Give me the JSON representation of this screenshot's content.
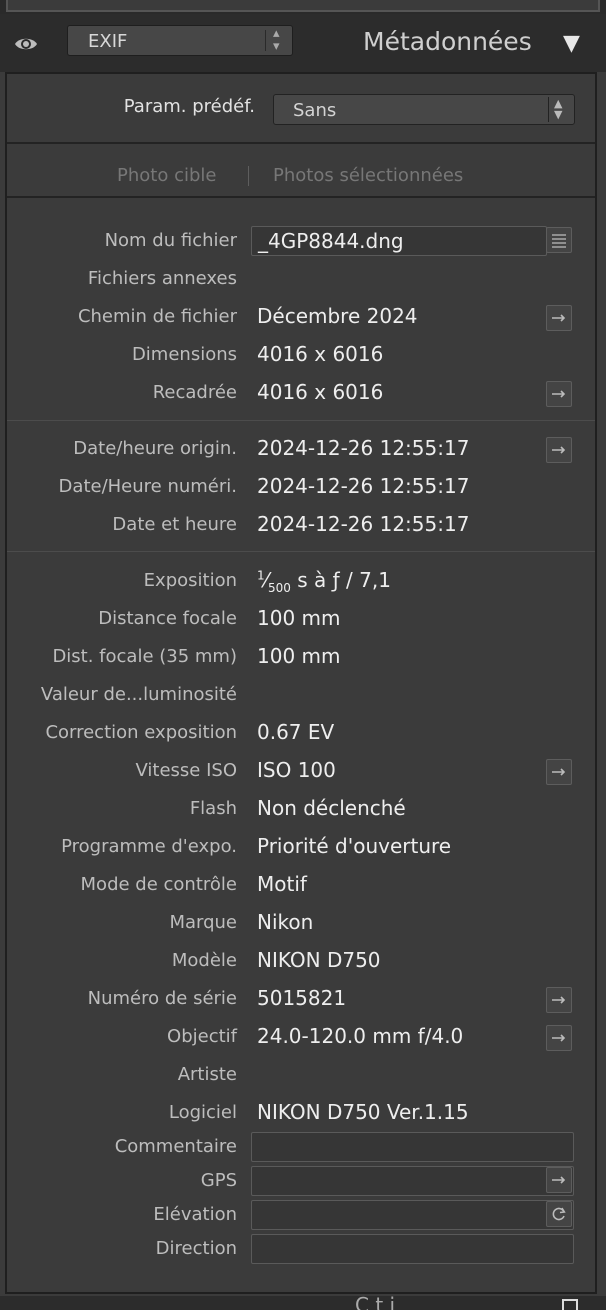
{
  "header": {
    "mode_value": "EXIF",
    "title": "Métadonnées",
    "collapse_glyph": "▼",
    "eye_icon": "eye-icon"
  },
  "preset": {
    "label": "Param. prédéf.",
    "value": "Sans"
  },
  "tabs": {
    "target_photo": "Photo cible",
    "selected_photos": "Photos sélectionnées"
  },
  "fields": {
    "filename": {
      "label": "Nom du fichier",
      "value": "_4GP8844.dng"
    },
    "sidecar": {
      "label": "Fichiers annexes",
      "value": ""
    },
    "folder": {
      "label": "Chemin de fichier",
      "value": "Décembre 2024"
    },
    "dimensions": {
      "label": "Dimensions",
      "value": "4016 x 6016"
    },
    "cropped": {
      "label": "Recadrée",
      "value": "4016 x 6016"
    },
    "date_original": {
      "label": "Date/heure origin.",
      "value": "2024-12-26 12:55:17"
    },
    "date_digitized": {
      "label": "Date/Heure numéri.",
      "value": "2024-12-26 12:55:17"
    },
    "date_time": {
      "label": "Date et heure",
      "value": "2024-12-26 12:55:17"
    },
    "exposure": {
      "label": "Exposition",
      "value_num": "1",
      "value_den": "500",
      "value_rest": " s à ƒ / 7,1"
    },
    "focal_length": {
      "label": "Distance focale",
      "value": "100 mm"
    },
    "focal_35": {
      "label": "Dist. focale (35 mm)",
      "value": "100 mm"
    },
    "brightness": {
      "label": "Valeur de...luminosité",
      "value": ""
    },
    "exposure_bias": {
      "label": "Correction exposition",
      "value": "0.67 EV"
    },
    "iso": {
      "label": "Vitesse ISO",
      "value": "ISO 100"
    },
    "flash": {
      "label": "Flash",
      "value": "Non déclenché"
    },
    "program": {
      "label": "Programme d'expo.",
      "value": "Priorité d'ouverture"
    },
    "metering": {
      "label": "Mode de contrôle",
      "value": "Motif"
    },
    "make": {
      "label": "Marque",
      "value": "Nikon"
    },
    "model": {
      "label": "Modèle",
      "value": "NIKON D750"
    },
    "serial": {
      "label": "Numéro de série",
      "value": "5015821"
    },
    "lens": {
      "label": "Objectif",
      "value": "24.0-120.0 mm f/4.0"
    },
    "artist": {
      "label": "Artiste",
      "value": ""
    },
    "software": {
      "label": "Logiciel",
      "value": "NIKON D750 Ver.1.15"
    },
    "comment": {
      "label": "Commentaire",
      "value": ""
    },
    "gps": {
      "label": "GPS",
      "value": ""
    },
    "elevation": {
      "label": "Elévation",
      "value": ""
    },
    "direction": {
      "label": "Direction",
      "value": ""
    }
  },
  "footer": {
    "partial_text": "C                   t  i"
  }
}
